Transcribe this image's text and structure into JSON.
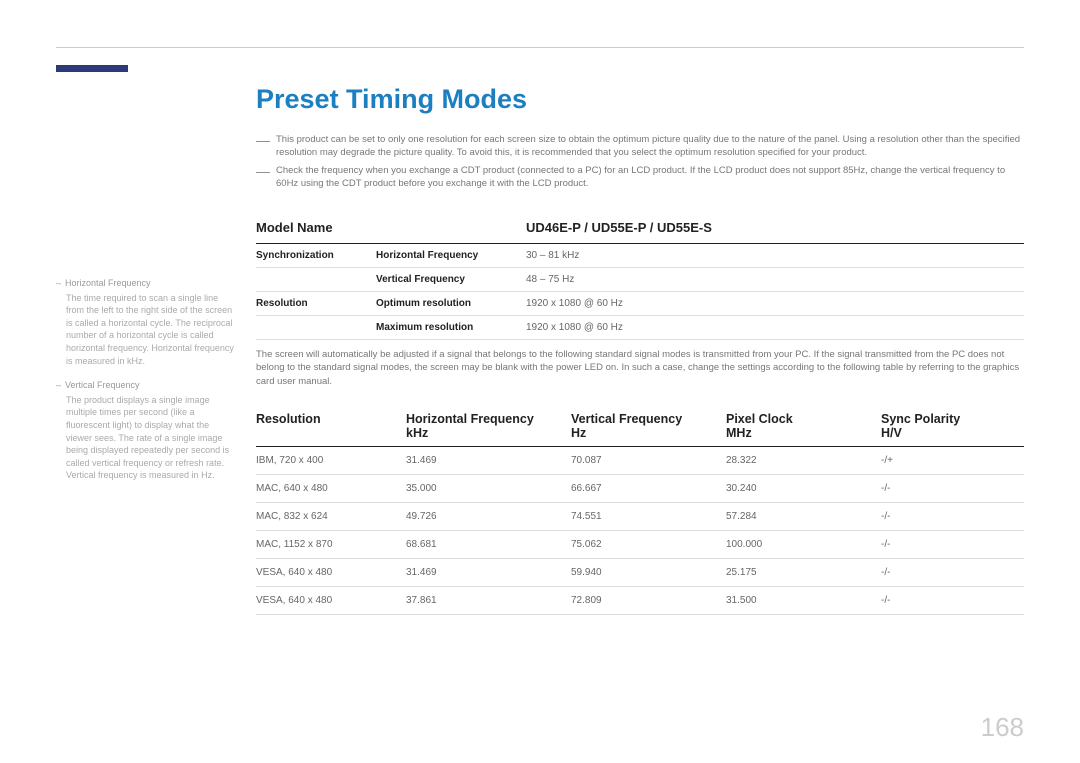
{
  "title": "Preset Timing Modes",
  "notes": [
    "This product can be set to only one resolution for each screen size to obtain the optimum picture quality due to the nature of the panel. Using a resolution other than the specified resolution may degrade the picture quality. To avoid this, it is recommended that you select the optimum resolution specified for your product.",
    "Check the frequency when you exchange a CDT product (connected to a PC) for an LCD product. If the LCD product does not support 85Hz, change the vertical frequency to 60Hz using the CDT product before you exchange it with the LCD product."
  ],
  "sidebar": [
    {
      "title": "Horizontal Frequency",
      "body": "The time required to scan a single line from the left to the right side of the screen is called a horizontal cycle. The reciprocal number of a horizontal cycle is called horizontal frequency. Horizontal frequency is measured in kHz."
    },
    {
      "title": "Vertical Frequency",
      "body": "The product displays a single image multiple times per second (like a fluorescent light) to display what the viewer sees. The rate of a single image being displayed repeatedly per second is called vertical frequency or refresh rate. Vertical frequency is measured in Hz."
    }
  ],
  "model": {
    "label": "Model Name",
    "value": "UD46E-P / UD55E-P / UD55E-S"
  },
  "spec": [
    {
      "group": "Synchronization",
      "label": "Horizontal Frequency",
      "value": "30 – 81 kHz"
    },
    {
      "group": "",
      "label": "Vertical Frequency",
      "value": "48 – 75 Hz"
    },
    {
      "group": "Resolution",
      "label": "Optimum resolution",
      "value": "1920 x 1080 @ 60 Hz"
    },
    {
      "group": "",
      "label": "Maximum resolution",
      "value": "1920 x 1080 @ 60 Hz"
    }
  ],
  "para": "The screen will automatically be adjusted if a signal that belongs to the following standard signal modes is transmitted from your PC. If the signal transmitted from the PC does not belong to the standard signal modes, the screen may be blank with the power LED on. In such a case, change the settings according to the following table by referring to the graphics card user manual.",
  "timing_headers": {
    "c1": "Resolution",
    "c2a": "Horizontal Frequency",
    "c2b": "kHz",
    "c3a": "Vertical Frequency",
    "c3b": "Hz",
    "c4a": "Pixel Clock",
    "c4b": "MHz",
    "c5a": "Sync Polarity",
    "c5b": "H/V"
  },
  "timing_rows": [
    {
      "res": "IBM, 720 x 400",
      "hf": "31.469",
      "vf": "70.087",
      "pc": "28.322",
      "sp": "-/+"
    },
    {
      "res": "MAC, 640 x 480",
      "hf": "35.000",
      "vf": "66.667",
      "pc": "30.240",
      "sp": "-/-"
    },
    {
      "res": "MAC, 832 x 624",
      "hf": "49.726",
      "vf": "74.551",
      "pc": "57.284",
      "sp": "-/-"
    },
    {
      "res": "MAC, 1152 x 870",
      "hf": "68.681",
      "vf": "75.062",
      "pc": "100.000",
      "sp": "-/-"
    },
    {
      "res": "VESA, 640 x 480",
      "hf": "31.469",
      "vf": "59.940",
      "pc": "25.175",
      "sp": "-/-"
    },
    {
      "res": "VESA, 640 x 480",
      "hf": "37.861",
      "vf": "72.809",
      "pc": "31.500",
      "sp": "-/-"
    }
  ],
  "page_number": "168"
}
